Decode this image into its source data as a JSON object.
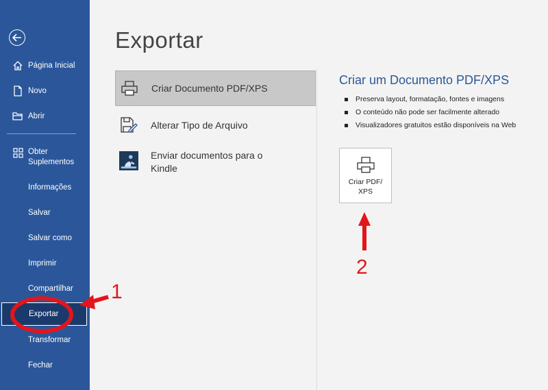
{
  "sidebar": {
    "items": [
      {
        "label": "Página Inicial",
        "icon": "home-icon"
      },
      {
        "label": "Novo",
        "icon": "new-document-icon"
      },
      {
        "label": "Abrir",
        "icon": "open-folder-icon"
      },
      {
        "label": "Obter Suplementos",
        "icon": "add-ins-icon"
      },
      {
        "label": "Informações"
      },
      {
        "label": "Salvar"
      },
      {
        "label": "Salvar como"
      },
      {
        "label": "Imprimir"
      },
      {
        "label": "Compartilhar"
      },
      {
        "label": "Exportar",
        "active": true
      },
      {
        "label": "Transformar"
      },
      {
        "label": "Fechar"
      }
    ]
  },
  "main": {
    "title": "Exportar",
    "options": [
      {
        "label": "Criar Documento PDF/XPS",
        "icon": "printer-icon",
        "selected": true
      },
      {
        "label": "Alterar Tipo de Arquivo",
        "icon": "change-file-type-icon"
      },
      {
        "label": "Enviar documentos para o Kindle",
        "icon": "kindle-icon"
      }
    ]
  },
  "detail": {
    "title": "Criar um Documento PDF/XPS",
    "bullets": [
      "Preserva layout, formatação, fontes e imagens",
      "O conteúdo não pode ser facilmente alterado",
      "Visualizadores gratuitos estão disponíveis na Web"
    ],
    "button_label": "Criar PDF/ XPS"
  },
  "annotations": {
    "step1": "1",
    "step2": "2",
    "color": "#e3151b"
  },
  "colors": {
    "sidebar_bg": "#2b579a",
    "active_bg": "#1a3a6c",
    "accent": "#2b579a"
  }
}
